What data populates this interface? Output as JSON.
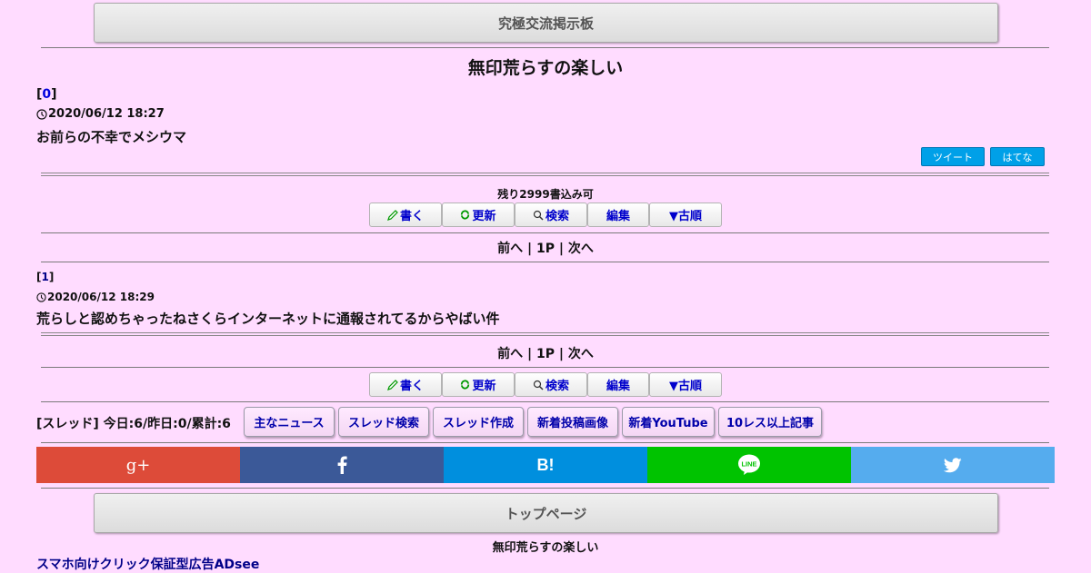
{
  "top_button": "究極交流掲示板",
  "thread_title": "無印荒らすの楽しい",
  "post0": {
    "bracket_open": "[",
    "num": "0",
    "bracket_close": "]",
    "clock_icon": "clock-icon",
    "date": "2020/06/12 18:27",
    "body": "お前らの不幸でメシウマ"
  },
  "share": {
    "tweet": "ツイート",
    "hatena": "はてな"
  },
  "remaining": "残り2999書込み可",
  "toolbar": {
    "write": "書く",
    "write_icon": "pencil-icon",
    "refresh": "更新",
    "refresh_icon": "refresh-icon",
    "search": "検索",
    "search_icon": "magnifier-icon",
    "edit": "編集",
    "old": "▼古順"
  },
  "pager": {
    "prev": "前へ",
    "sep1": "|",
    "page": "1P",
    "sep2": "|",
    "next": "次へ"
  },
  "post1": {
    "bracket_open": "[",
    "num": "1",
    "bracket_close": "]",
    "clock_icon": "clock-icon",
    "date": "2020/06/12 18:29",
    "body": "荒らしと認めちゃったねさくらインターネットに通報されてるからやばい件"
  },
  "stats": "[スレッド] 今日:6/昨日:0/累計:6",
  "footer_buttons": [
    "主なニュース",
    "スレッド検索",
    "スレッド作成",
    "新着投稿画像",
    "新着YouTube",
    "10レス以上記事"
  ],
  "social": {
    "gplus_icon": "google-plus-icon",
    "gplus_text": "g+",
    "facebook_icon": "facebook-icon",
    "hatena_icon": "hatena-bookmark-icon",
    "hatena_text": "B!",
    "line_icon": "line-icon",
    "line_text": "LINE",
    "twitter_icon": "twitter-icon",
    "colors": {
      "gplus": "#dd4b39",
      "facebook": "#3b5998",
      "hatena": "#008fde",
      "line": "#00c300",
      "twitter": "#55acee"
    }
  },
  "top_page_button": "トップページ",
  "footer_title": "無印荒らすの楽しい",
  "ad_link": "スマホ向けクリック保証型広告ADsee"
}
